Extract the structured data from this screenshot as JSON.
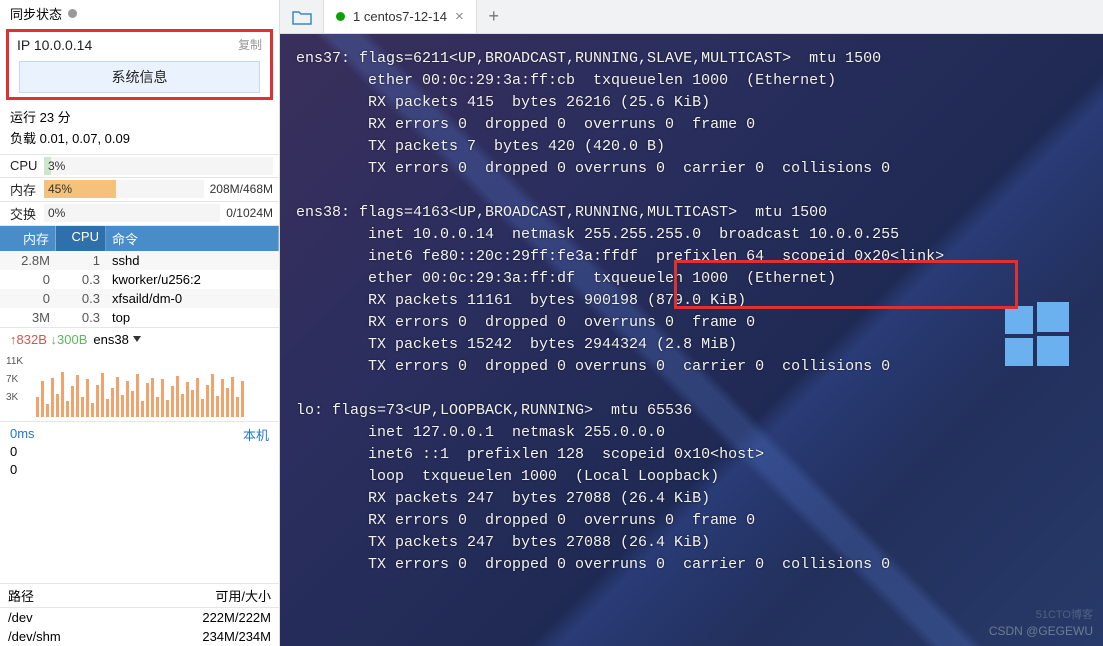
{
  "sync": {
    "label": "同步状态"
  },
  "ip": {
    "label": "IP 10.0.0.14",
    "copy": "复制",
    "sysinfo_btn": "系统信息"
  },
  "runtime": {
    "line": "运行 23 分",
    "load_label": "负载 0.01, 0.07, 0.09"
  },
  "stats": {
    "cpu_label": "CPU",
    "cpu_pct": "3%",
    "mem_label": "内存",
    "mem_pct": "45%",
    "mem_right": "208M/468M",
    "swap_label": "交换",
    "swap_pct": "0%",
    "swap_right": "0/1024M"
  },
  "proc": {
    "h_mem": "内存",
    "h_cpu": "CPU",
    "h_cmd": "命令",
    "rows": [
      {
        "mem": "2.8M",
        "cpu": "1",
        "cmd": "sshd"
      },
      {
        "mem": "0",
        "cpu": "0.3",
        "cmd": "kworker/u256:2"
      },
      {
        "mem": "0",
        "cpu": "0.3",
        "cmd": "xfsaild/dm-0"
      },
      {
        "mem": "3M",
        "cpu": "0.3",
        "cmd": "top"
      }
    ]
  },
  "net": {
    "up": "↑832B",
    "down": "↓300B",
    "iface": "ens38",
    "y1": "11K",
    "y2": "7K",
    "y3": "3K"
  },
  "latency": {
    "ms": "0ms",
    "v1": "0",
    "v2": "0",
    "label": "本机"
  },
  "disk": {
    "h_path": "路径",
    "h_size": "可用/大小",
    "rows": [
      {
        "path": "/dev",
        "size": "222M/222M"
      },
      {
        "path": "/dev/shm",
        "size": "234M/234M"
      }
    ]
  },
  "tab": {
    "title": "1 centos7-12-14"
  },
  "term": {
    "lines": [
      "ens37: flags=6211<UP,BROADCAST,RUNNING,SLAVE,MULTICAST>  mtu 1500",
      "        ether 00:0c:29:3a:ff:cb  txqueuelen 1000  (Ethernet)",
      "        RX packets 415  bytes 26216 (25.6 KiB)",
      "        RX errors 0  dropped 0  overruns 0  frame 0",
      "        TX packets 7  bytes 420 (420.0 B)",
      "        TX errors 0  dropped 0 overruns 0  carrier 0  collisions 0",
      "",
      "ens38: flags=4163<UP,BROADCAST,RUNNING,MULTICAST>  mtu 1500",
      "        inet 10.0.0.14  netmask 255.255.255.0  broadcast 10.0.0.255",
      "        inet6 fe80::20c:29ff:fe3a:ffdf  prefixlen 64  scopeid 0x20<link>",
      "        ether 00:0c:29:3a:ff:df  txqueuelen 1000  (Ethernet)",
      "        RX packets 11161  bytes 900198 (879.0 KiB)",
      "        RX errors 0  dropped 0  overruns 0  frame 0",
      "        TX packets 15242  bytes 2944324 (2.8 MiB)",
      "        TX errors 0  dropped 0 overruns 0  carrier 0  collisions 0",
      "",
      "lo: flags=73<UP,LOOPBACK,RUNNING>  mtu 65536",
      "        inet 127.0.0.1  netmask 255.0.0.0",
      "        inet6 ::1  prefixlen 128  scopeid 0x10<host>",
      "        loop  txqueuelen 1000  (Local Loopback)",
      "        RX packets 247  bytes 27088 (26.4 KiB)",
      "        RX errors 0  dropped 0  overruns 0  frame 0",
      "        TX packets 247  bytes 27088 (26.4 KiB)",
      "        TX errors 0  dropped 0 overruns 0  carrier 0  collisions 0"
    ]
  },
  "wm": {
    "line1": "51CTO博客",
    "line2": "CSDN @GEGEWU"
  }
}
